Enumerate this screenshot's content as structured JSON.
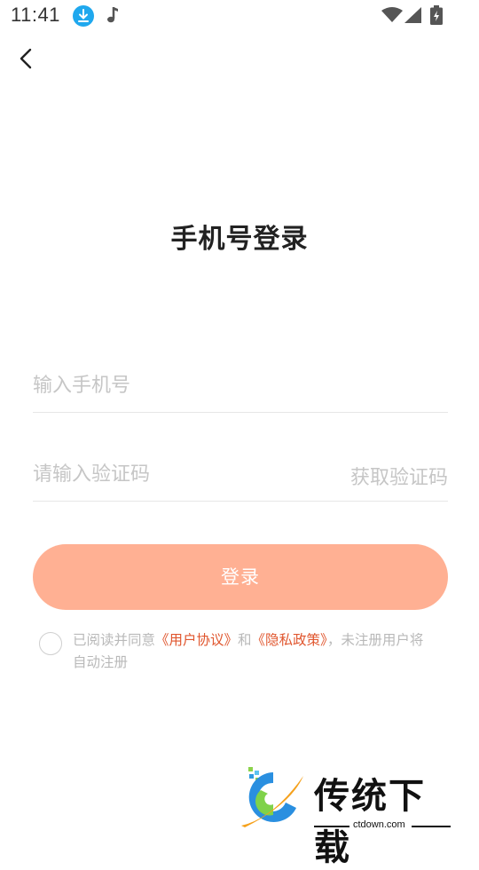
{
  "status_bar": {
    "time": "11:41"
  },
  "page": {
    "title": "手机号登录"
  },
  "form": {
    "phone_placeholder": "输入手机号",
    "code_placeholder": "请输入验证码",
    "get_code_label": "获取验证码",
    "login_label": "登录"
  },
  "agreement": {
    "prefix": "已阅读并同意",
    "user_agreement": "《用户协议》",
    "and": "和",
    "privacy_policy": "《隐私政策》",
    "suffix": "，未注册用户将自动注册"
  },
  "watermark": {
    "name": "传统下载",
    "url": "ctdown.com"
  },
  "colors": {
    "login_button": "#ffb093",
    "link": "#e0562e",
    "placeholder": "#c6c6c6"
  }
}
